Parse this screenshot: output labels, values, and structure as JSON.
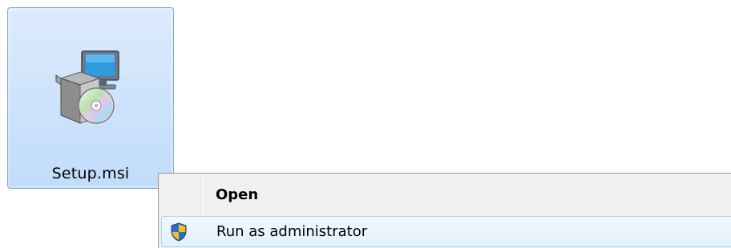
{
  "file": {
    "name": "Setup.msi",
    "icon": "installer-package-icon"
  },
  "context_menu": {
    "items": [
      {
        "label": "Open",
        "default": true,
        "icon": ""
      },
      {
        "label": "Run as administrator",
        "default": false,
        "icon": "uac-shield-icon"
      }
    ]
  },
  "colors": {
    "selection_fill": "#c9e0fb",
    "selection_border": "#84acdd",
    "menu_background": "#f0f0f0",
    "menu_border": "#979797",
    "hover_border": "#a8d8f0"
  }
}
